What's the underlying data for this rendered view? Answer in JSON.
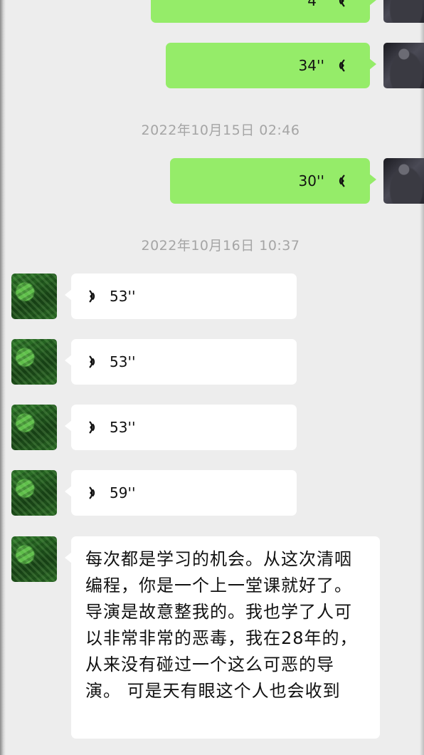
{
  "timestamps": {
    "oct15": "2022年10月15日 02:46",
    "oct16": "2022年10月16日 10:37"
  },
  "messages_me": [
    {
      "duration": "4''"
    },
    {
      "duration": "34''"
    },
    {
      "duration": "30''"
    }
  ],
  "messages_other": [
    {
      "duration": "53''"
    },
    {
      "duration": "53''"
    },
    {
      "duration": "53''"
    },
    {
      "duration": "59''"
    }
  ],
  "text_message": "每次都是学习的机会。从这次清咽编程，你是一个上一堂课就好了。 导演是故意整我的。我也学了人可以非常非常的恶毒，我在28年的，从来没有碰过一个这么可恶的导演。 可是天有眼这个人也会收到",
  "colors": {
    "background": "#EDEDED",
    "my_bubble": "#95EC69",
    "other_bubble": "#FFFFFF",
    "timestamp": "#A5A5A5"
  },
  "icons": [
    "voice-wave-icon"
  ]
}
